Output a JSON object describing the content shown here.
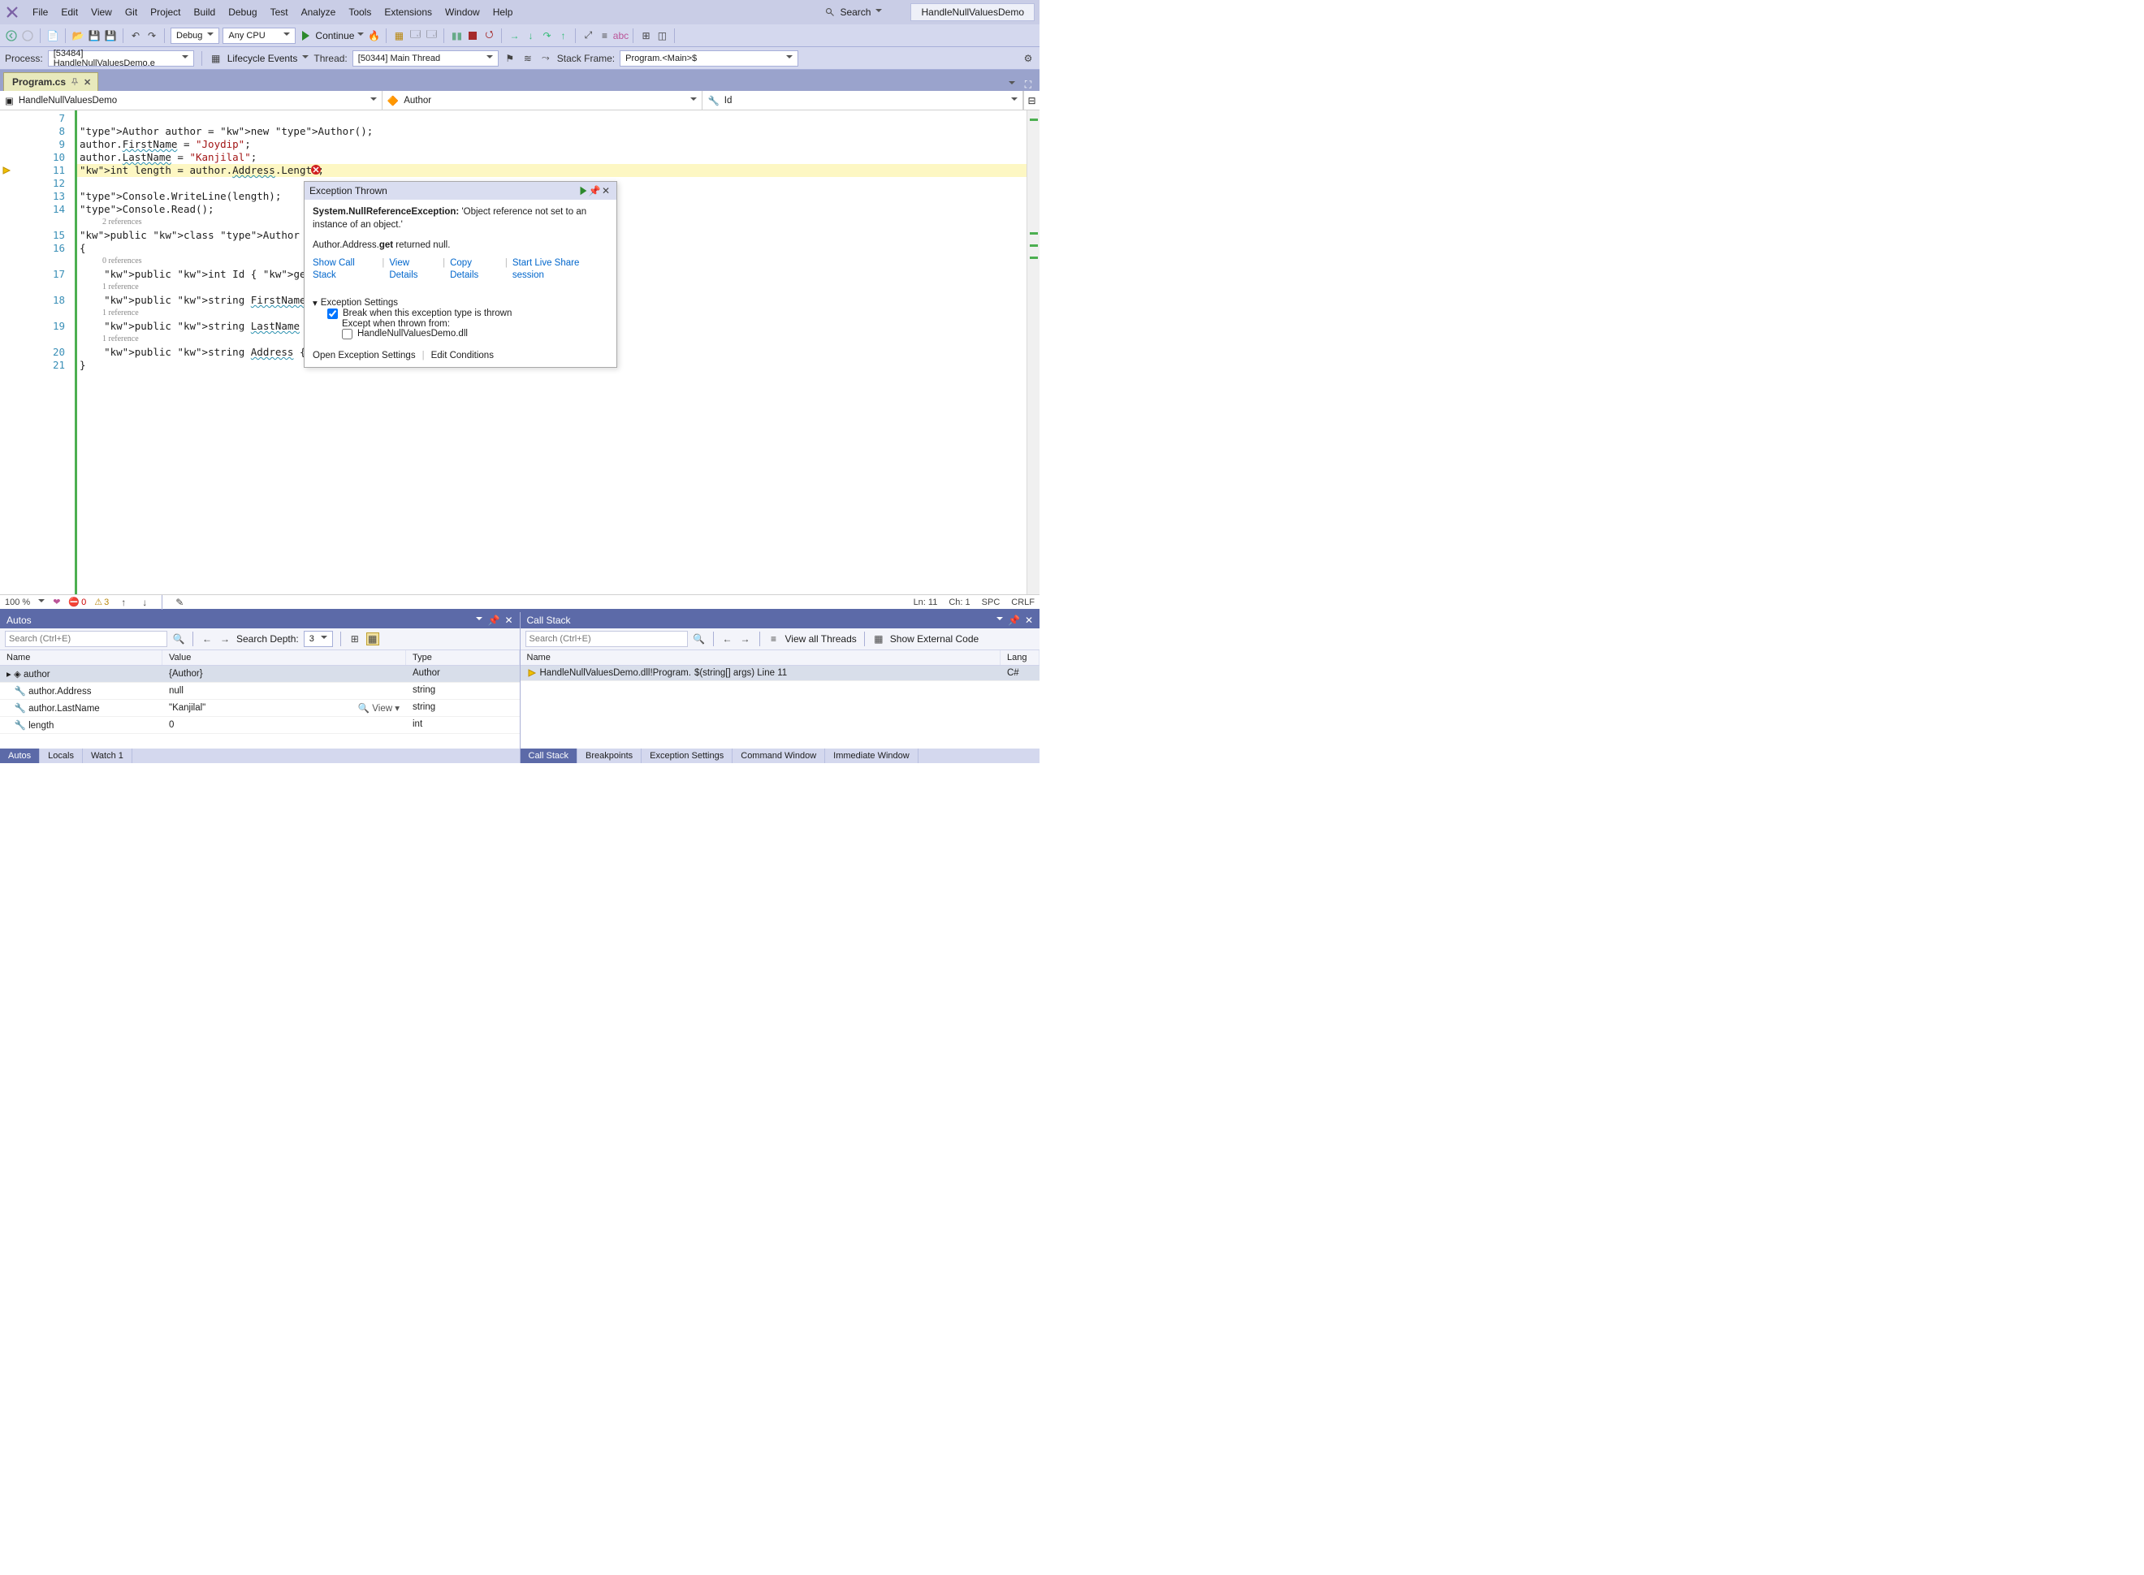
{
  "menu": [
    "File",
    "Edit",
    "View",
    "Git",
    "Project",
    "Build",
    "Debug",
    "Test",
    "Analyze",
    "Tools",
    "Extensions",
    "Window",
    "Help"
  ],
  "search_label": "Search",
  "solution_name": "HandleNullValuesDemo",
  "toolbar": {
    "config": "Debug",
    "platform": "Any CPU",
    "continue_label": "Continue"
  },
  "debugbar": {
    "process_label": "Process:",
    "process": "[53484] HandleNullValuesDemo.e",
    "lifecycle_label": "Lifecycle Events",
    "thread_label": "Thread:",
    "thread": "[50344] Main Thread",
    "stackframe_label": "Stack Frame:",
    "stackframe": "Program.<Main>$"
  },
  "tab": {
    "name": "Program.cs"
  },
  "nav": {
    "left": "HandleNullValuesDemo",
    "mid": "Author",
    "right": "Id"
  },
  "code": {
    "lines": [
      {
        "n": 7,
        "t": ""
      },
      {
        "n": 8,
        "t": "Author author = new Author();"
      },
      {
        "n": 9,
        "t": "author.FirstName = \"Joydip\";"
      },
      {
        "n": 10,
        "t": "author.LastName = \"Kanjilal\";"
      },
      {
        "n": 11,
        "t": "int length = author.Address.Length;",
        "current": true
      },
      {
        "n": 12,
        "t": ""
      },
      {
        "n": 13,
        "t": "Console.WriteLine(length);"
      },
      {
        "n": 14,
        "t": "Console.Read();"
      },
      {
        "codelens": "2 references"
      },
      {
        "n": 15,
        "t": "public class Author"
      },
      {
        "n": 16,
        "t": "{"
      },
      {
        "codelens": "0 references"
      },
      {
        "n": 17,
        "t": "    public int Id { get; set; }"
      },
      {
        "codelens": "1 reference"
      },
      {
        "n": 18,
        "t": "    public string FirstName { get; s"
      },
      {
        "codelens": "1 reference"
      },
      {
        "n": 19,
        "t": "    public string LastName { get; se"
      },
      {
        "codelens": "1 reference"
      },
      {
        "n": 20,
        "t": "    public string Address { get; set"
      },
      {
        "n": 21,
        "t": "}"
      }
    ]
  },
  "exception": {
    "title": "Exception Thrown",
    "type": "System.NullReferenceException:",
    "message": "'Object reference not set to an instance of an object.'",
    "detail_pre": "Author.Address.",
    "detail_bold": "get",
    "detail_post": " returned null.",
    "links": [
      "Show Call Stack",
      "View Details",
      "Copy Details",
      "Start Live Share session"
    ],
    "settings_hdr": "Exception Settings",
    "cb1": "Break when this exception type is thrown",
    "cb1_checked": true,
    "except_lbl": "Except when thrown from:",
    "cb2": "HandleNullValuesDemo.dll",
    "cb2_checked": false,
    "bottom_links": [
      "Open Exception Settings",
      "Edit Conditions"
    ]
  },
  "editor_status": {
    "zoom": "100 %",
    "errors": "0",
    "warnings": "3",
    "ln": "Ln: 11",
    "ch": "Ch: 1",
    "spc": "SPC",
    "crlf": "CRLF"
  },
  "autos": {
    "title": "Autos",
    "search_ph": "Search (Ctrl+E)",
    "depth_lbl": "Search Depth:",
    "depth": "3",
    "cols": [
      "Name",
      "Value",
      "Type"
    ],
    "rows": [
      {
        "name": "author",
        "value": "{Author}",
        "type": "Author",
        "expand": true,
        "sel": true
      },
      {
        "name": "author.Address",
        "value": "null",
        "type": "string"
      },
      {
        "name": "author.LastName",
        "value": "\"Kanjilal\"",
        "type": "string",
        "view": true
      },
      {
        "name": "length",
        "value": "0",
        "type": "int"
      }
    ],
    "tabs": [
      "Autos",
      "Locals",
      "Watch 1"
    ],
    "view_label": "View"
  },
  "callstack": {
    "title": "Call Stack",
    "search_ph": "Search (Ctrl+E)",
    "view_threads": "View all Threads",
    "show_ext": "Show External Code",
    "cols": [
      "Name",
      "Lang"
    ],
    "rows": [
      {
        "name": "HandleNullValuesDemo.dll!Program.<Main>$(string[] args) Line 11",
        "lang": "C#",
        "current": true
      }
    ],
    "tabs": [
      "Call Stack",
      "Breakpoints",
      "Exception Settings",
      "Command Window",
      "Immediate Window"
    ]
  }
}
